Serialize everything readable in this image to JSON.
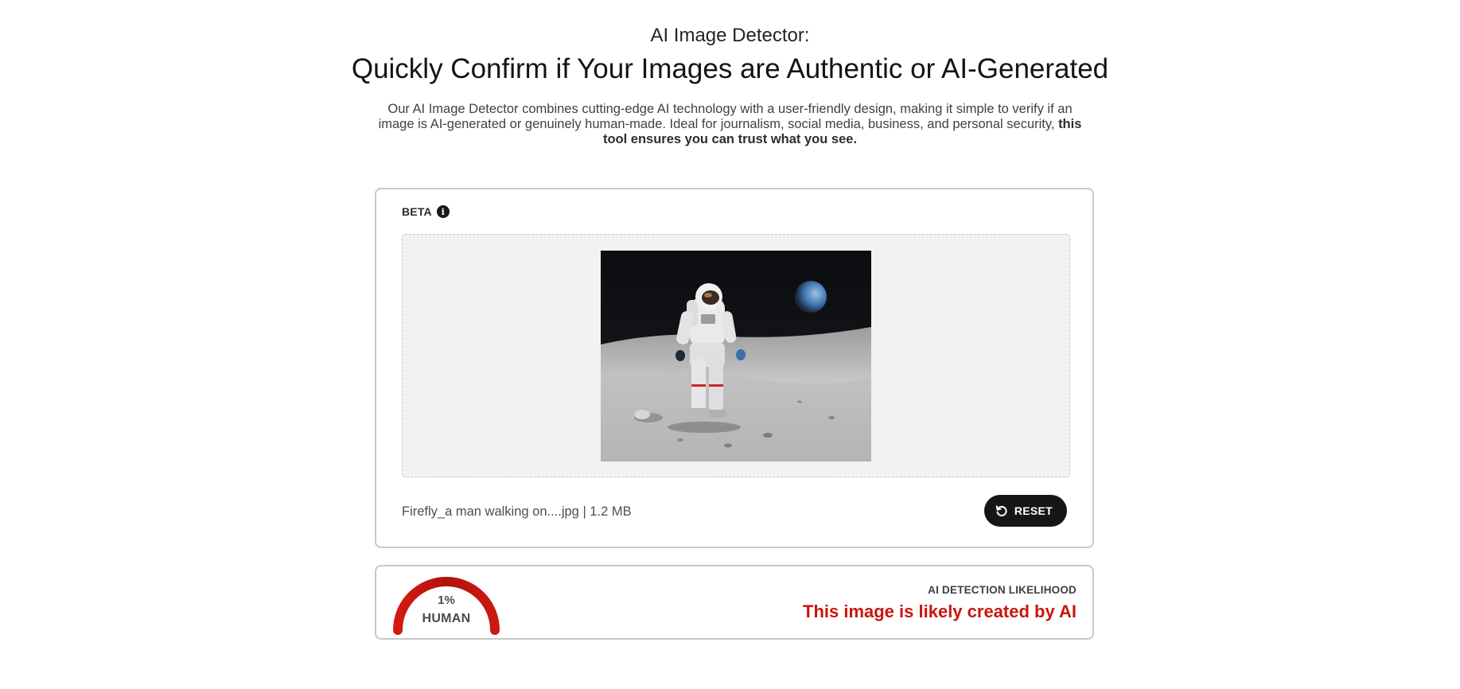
{
  "header": {
    "eyebrow": "AI Image Detector:",
    "title": "Quickly Confirm if Your Images are Authentic or AI-Generated",
    "description": "Our AI Image Detector combines cutting-edge AI technology with a user-friendly design, making it simple to verify if an image is AI-generated or genuinely human-made. Ideal for journalism, social media, business, and personal security, ",
    "description_bold": "this tool ensures you can trust what you see."
  },
  "upload": {
    "beta_label": "BETA",
    "info_icon": "info-icon",
    "file_info": "Firefly_a man walking on....jpg | 1.2 MB",
    "reset_label": "RESET",
    "reset_icon": "rotate-ccw-icon"
  },
  "result": {
    "percent_text": "1%",
    "percent_value": 1,
    "verdict_short": "HUMAN",
    "likelihood_label": "AI DETECTION LIKELIHOOD",
    "verdict_text": "This image is likely created by AI",
    "accent_color": "#c8160f"
  }
}
